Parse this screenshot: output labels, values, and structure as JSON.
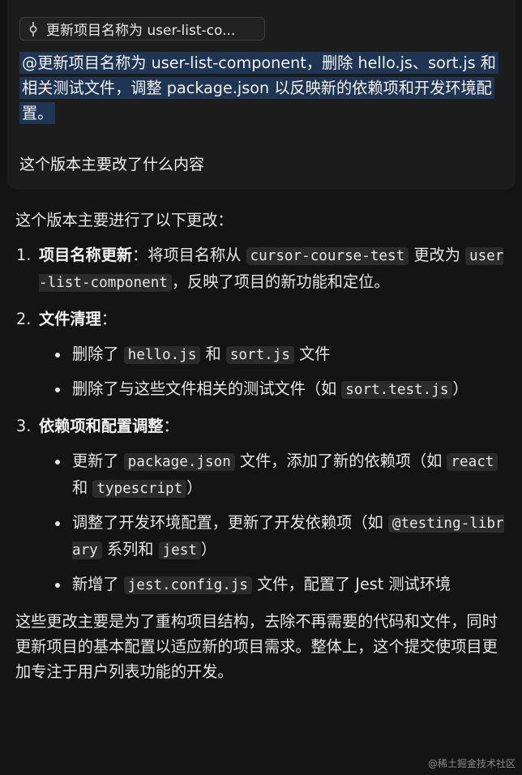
{
  "prompt": {
    "commit_chip": "更新项目名称为 user-list-co...",
    "commit_icon": "git-commit-icon",
    "mention": "@更新项目名称为 user-list-component，删除 hello.js、sort.js 和相关测试文件，调整 package.json 以反映新的依赖项和开发环境配置。",
    "question": "这个版本主要改了什么内容"
  },
  "answer": {
    "intro": "这个版本主要进行了以下更改：",
    "items": [
      {
        "num": "1.",
        "title": "项目名称更新",
        "colon": "：",
        "t1": "将项目名称从 ",
        "c1": "cursor-course-test",
        "t2": " 更改为 ",
        "c2": "user-list-component",
        "t3": "，反映了项目的新功能和定位。"
      },
      {
        "num": "2.",
        "title": "文件清理",
        "colon": "：",
        "subs": [
          {
            "t1": "删除了 ",
            "c1": "hello.js",
            "t2": " 和 ",
            "c2": "sort.js",
            "t3": " 文件"
          },
          {
            "t1": "删除了与这些文件相关的测试文件（如 ",
            "c1": "sort.test.js",
            "t2": "）"
          }
        ]
      },
      {
        "num": "3.",
        "title": "依赖项和配置调整",
        "colon": "：",
        "subs": [
          {
            "t1": "更新了 ",
            "c1": "package.json",
            "t2": " 文件，添加了新的依赖项（如 ",
            "c2": "react",
            "t3": " 和 ",
            "c3": "typescript",
            "t4": "）"
          },
          {
            "t1": "调整了开发环境配置，更新了开发依赖项（如 ",
            "c1": "@testing-library",
            "t2": " 系列和 ",
            "c2": "jest",
            "t3": "）"
          },
          {
            "t1": "新增了 ",
            "c1": "jest.config.js",
            "t2": " 文件，配置了 Jest 测试环境"
          }
        ]
      }
    ],
    "conclusion": "这些更改主要是为了重构项目结构，去除不再需要的代码和文件，同时更新项目的基本配置以适应新的项目需求。整体上，这个提交使项目更加专注于用户列表功能的开发。"
  },
  "watermark": "@稀土掘金技术社区"
}
